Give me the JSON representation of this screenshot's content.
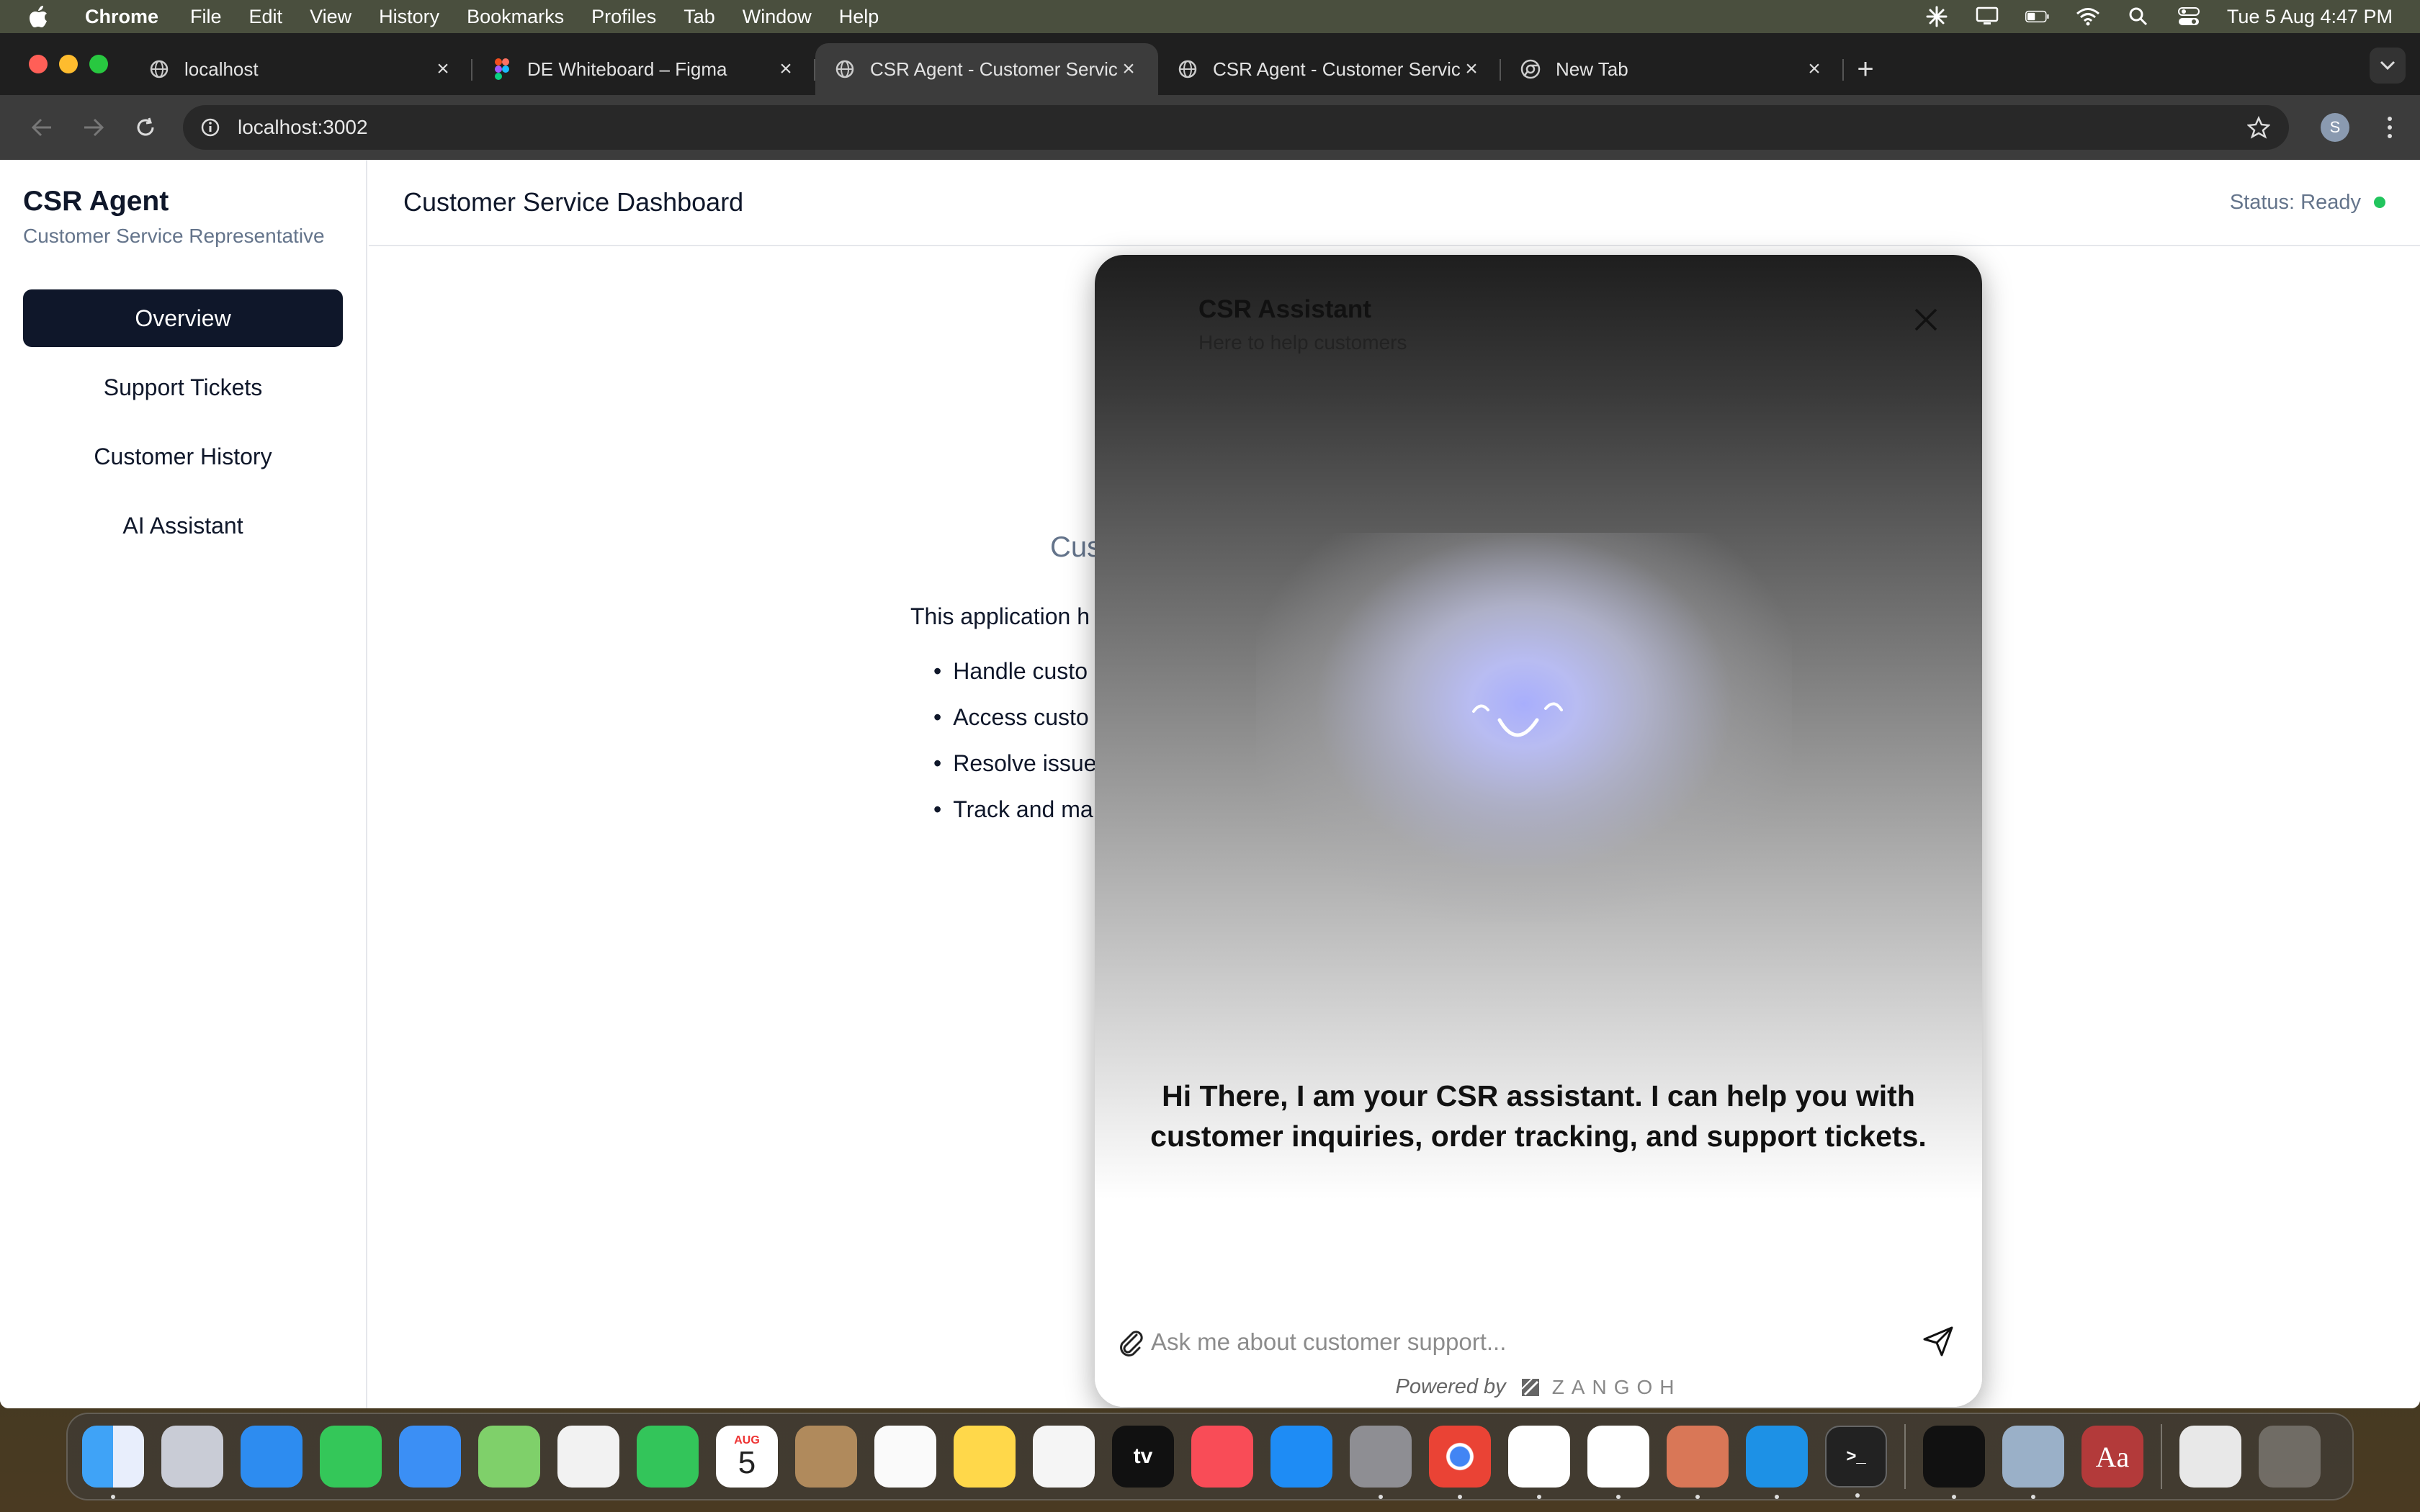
{
  "menubar": {
    "app": "Chrome",
    "items": [
      "File",
      "Edit",
      "View",
      "History",
      "Bookmarks",
      "Profiles",
      "Tab",
      "Window",
      "Help"
    ],
    "clock": "Tue 5 Aug  4:47 PM"
  },
  "browser": {
    "tabs": [
      {
        "title": "localhost",
        "icon": "globe-icon"
      },
      {
        "title": "DE Whiteboard – Figma",
        "icon": "figma-icon"
      },
      {
        "title": "CSR Agent - Customer Servic",
        "icon": "globe-icon",
        "active": true
      },
      {
        "title": "CSR Agent - Customer Servic",
        "icon": "globe-icon"
      },
      {
        "title": "New Tab",
        "icon": "chrome-icon"
      }
    ],
    "url": "localhost:3002",
    "profile_initial": "S"
  },
  "sidebar": {
    "brand": "CSR Agent",
    "subtitle": "Customer Service Representative",
    "items": [
      {
        "label": "Overview",
        "active": true
      },
      {
        "label": "Support Tickets"
      },
      {
        "label": "Customer History"
      },
      {
        "label": "AI Assistant"
      }
    ]
  },
  "header": {
    "title": "Customer Service Dashboard",
    "status": "Status: Ready",
    "status_color": "#22c55e"
  },
  "content": {
    "heading": "Cus",
    "intro": "This application h",
    "bullets": [
      "Handle custo",
      "Access custo",
      "Resolve issue",
      "Track and ma"
    ]
  },
  "chat": {
    "title": "CSR Assistant",
    "subtitle": "Here to help customers",
    "message": "Hi There, I am your CSR assistant. I can help you with customer inquiries, order tracking, and support tickets.",
    "input_placeholder": "Ask me about customer support...",
    "powered_by": "Powered by",
    "brand": "ZANGOH"
  },
  "dock": {
    "apps": [
      "Finder",
      "Launchpad",
      "Safari",
      "Messages",
      "Mail",
      "Maps",
      "Photos",
      "FaceTime",
      "Calendar",
      "Contacts",
      "Reminders",
      "Notes",
      "Freeform",
      "TV",
      "Music",
      "App Store",
      "System Settings",
      "Chrome",
      "VS Code",
      "Slack",
      "Claude",
      "Docker",
      "Terminal",
      "Cursor",
      "Preview",
      "Dictionary",
      "Downloads",
      "Trash"
    ],
    "calendar_month": "AUG",
    "calendar_day": "5",
    "dictionary_label": "Aa"
  },
  "colors": {
    "nav_active_bg": "#0f172a",
    "orb": "#a8aefc"
  }
}
